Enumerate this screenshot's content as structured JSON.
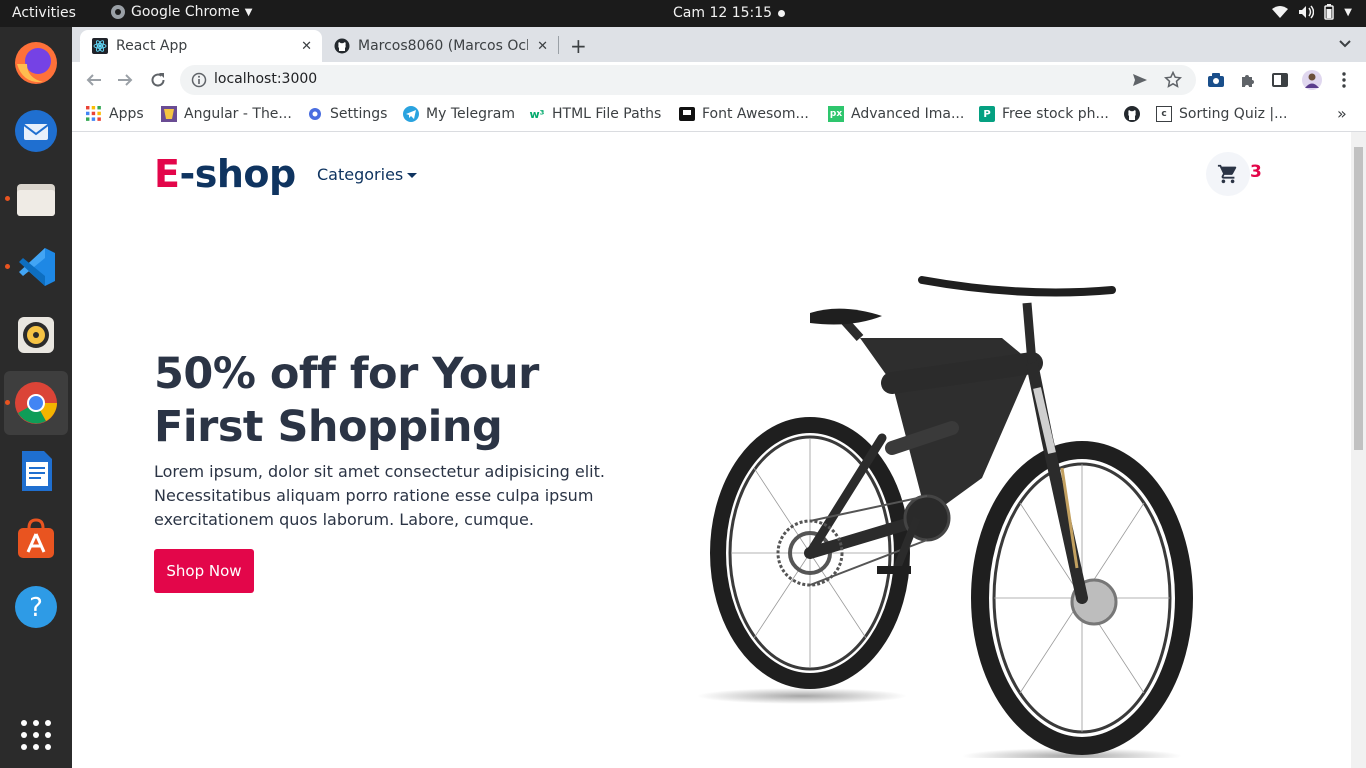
{
  "system": {
    "activities": "Activities",
    "app_name": "Google Chrome",
    "clock": "Cam 12  15:15"
  },
  "dock": {
    "items": [
      "firefox",
      "thunderbird",
      "files",
      "vscode",
      "rhythmbox",
      "chrome",
      "libreoffice-writer",
      "software-center",
      "help",
      "show-applications"
    ]
  },
  "browser": {
    "tabs": [
      {
        "title": "React App",
        "active": true
      },
      {
        "title": "Marcos8060 (Marcos Ochi",
        "active": false
      }
    ],
    "url": "localhost:3000",
    "bookmarks": [
      {
        "label": "Apps"
      },
      {
        "label": "Angular - The..."
      },
      {
        "label": "Settings"
      },
      {
        "label": "My Telegram"
      },
      {
        "label": "HTML File Paths"
      },
      {
        "label": "Font Awesom..."
      },
      {
        "label": "Advanced Ima..."
      },
      {
        "label": "Free stock ph..."
      },
      {
        "label": ""
      },
      {
        "label": "Sorting Quiz |..."
      }
    ],
    "overflow_label": "»"
  },
  "site": {
    "logo_accent": "E",
    "logo_rest": "-shop",
    "categories_label": "Categories",
    "cart_count": "3",
    "hero": {
      "title": "50% off for Your First Shopping",
      "text": "Lorem ipsum, dolor sit amet consectetur adipisicing elit. Necessitatibus aliquam porro ratione esse culpa ipsum exercitationem quos laborum. Labore, cumque.",
      "button": "Shop Now"
    }
  },
  "colors": {
    "accent": "#e3064a",
    "navy": "#0f3460",
    "text": "#2b3445"
  }
}
